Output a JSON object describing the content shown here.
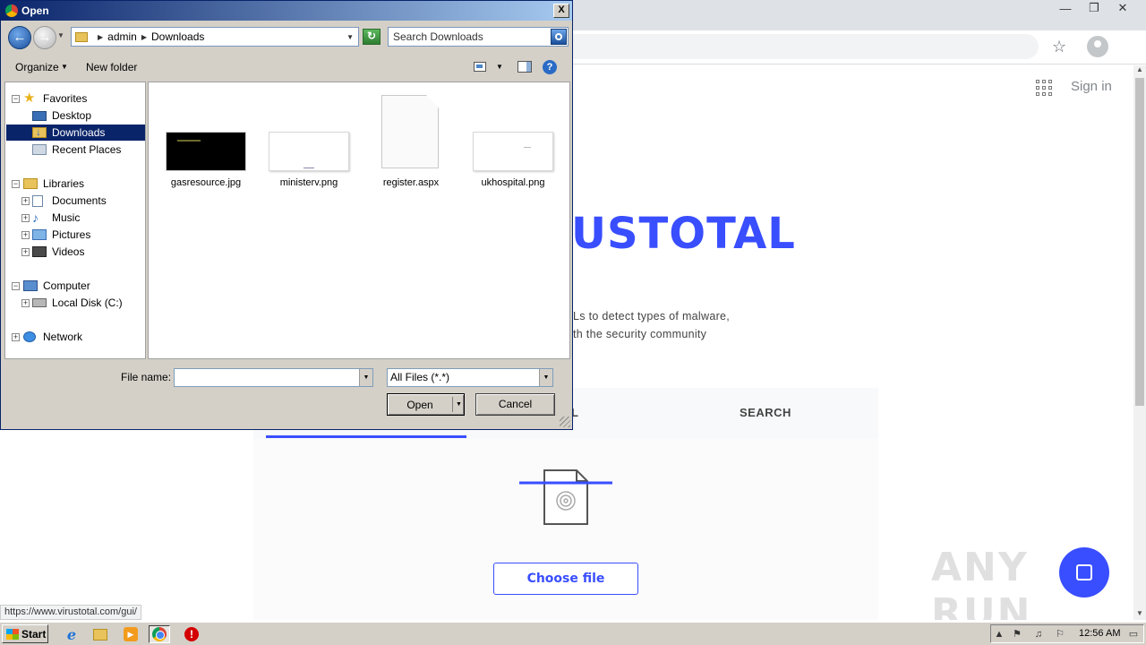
{
  "browser": {
    "window_controls": {
      "minimize": "—",
      "restore": "❐",
      "close": "✕"
    },
    "toolbar": {
      "bookmark_icon": "star-icon",
      "profile_icon": "avatar"
    },
    "status_url": "https://www.virustotal.com/gui/"
  },
  "virustotal": {
    "sign_in": "Sign in",
    "logo_visible": "USTOTAL",
    "desc_line1": "Ls to detect types of malware,",
    "desc_line2": "th the security community",
    "tab_url_partial": "L",
    "tab_search": "SEARCH",
    "choose_file": "Choose file",
    "accent_color": "#394eff"
  },
  "watermark": "ANY RUN",
  "dialog": {
    "title": "Open",
    "close_glyph": "X",
    "breadcrumb": [
      "admin",
      "Downloads"
    ],
    "search_placeholder": "Search Downloads",
    "toolbar": {
      "organize": "Organize",
      "new_folder": "New folder"
    },
    "nav": {
      "favorites": "Favorites",
      "desktop": "Desktop",
      "downloads": "Downloads",
      "recent_places": "Recent Places",
      "libraries": "Libraries",
      "documents": "Documents",
      "music": "Music",
      "pictures": "Pictures",
      "videos": "Videos",
      "computer": "Computer",
      "local_disk": "Local Disk (C:)",
      "network": "Network"
    },
    "files": [
      "gasresource.jpg",
      "ministerv.png",
      "register.aspx",
      "ukhospital.png"
    ],
    "file_name_label": "File name:",
    "file_name_value": "",
    "file_type": "All Files (*.*)",
    "open_button": "Open",
    "cancel_button": "Cancel"
  },
  "taskbar": {
    "start": "Start",
    "clock": "12:56 AM"
  }
}
